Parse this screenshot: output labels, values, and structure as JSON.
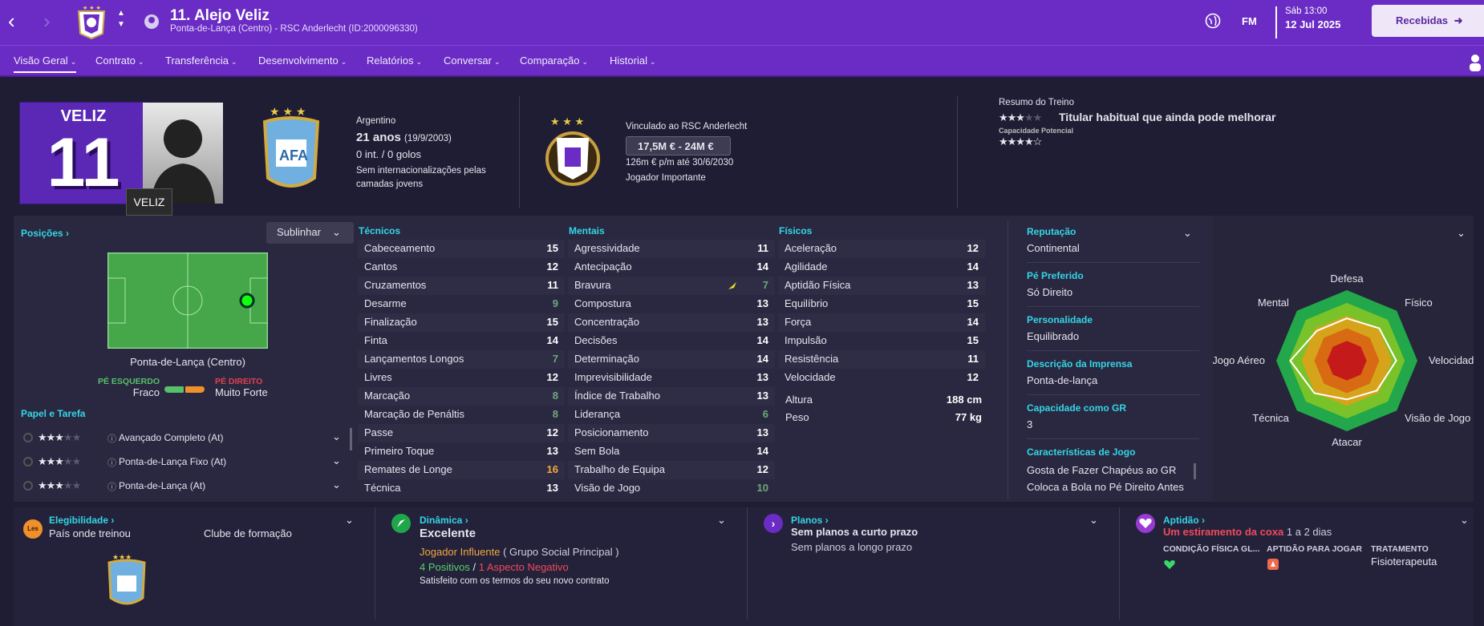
{
  "header": {
    "title": "11. Alejo Veliz",
    "subtitle": "Ponta-de-Lança (Centro) - RSC Anderlecht (ID:2000096330)",
    "fm": "FM",
    "time": "Sáb 13:00",
    "date": "12 Jul 2025",
    "inbox": "Recebidas"
  },
  "menu": [
    "Visão Geral",
    "Contrato",
    "Transferência",
    "Desenvolvimento",
    "Relatórios",
    "Conversar",
    "Comparação",
    "Historial"
  ],
  "profile": {
    "shirt_name": "VELIZ",
    "shirt_number": "11",
    "tooltip": "VELIZ",
    "nationality": "Argentino",
    "age": "21 anos",
    "dob": "(19/9/2003)",
    "caps": "0 int. / 0 golos",
    "youth": "Sem internacionalizações pelas camadas jovens",
    "contract_club": "Vinculado ao RSC Anderlecht",
    "value": "17,5M € - 24M €",
    "wage": "126m € p/m até 30/6/2030",
    "status": "Jogador Importante",
    "training_title": "Resumo do Treino",
    "training_text": "Titular habitual que ainda pode melhorar",
    "potential_label": "Capacidade Potencial",
    "current_stars": 3,
    "potential_stars": 4.5
  },
  "positions": {
    "label": "Posições",
    "highlight": "Sublinhar",
    "position": "Ponta-de-Lança (Centro)",
    "left_foot_label": "PÉ ESQUERDO",
    "left_foot": "Fraco",
    "right_foot_label": "PÉ DIREITO",
    "right_foot": "Muito Forte",
    "roles_label": "Papel e Tarefa",
    "roles": [
      "Avançado Completo (At)",
      "Ponta-de-Lança Fixo (At)",
      "Ponta-de-Lança (At)"
    ]
  },
  "technical": {
    "label": "Técnicos",
    "items": [
      {
        "n": "Cabeceamento",
        "v": "15"
      },
      {
        "n": "Cantos",
        "v": "12"
      },
      {
        "n": "Cruzamentos",
        "v": "11"
      },
      {
        "n": "Desarme",
        "v": "9"
      },
      {
        "n": "Finalização",
        "v": "15"
      },
      {
        "n": "Finta",
        "v": "14"
      },
      {
        "n": "Lançamentos Longos",
        "v": "7"
      },
      {
        "n": "Livres",
        "v": "12"
      },
      {
        "n": "Marcação",
        "v": "8"
      },
      {
        "n": "Marcação de Penáltis",
        "v": "8"
      },
      {
        "n": "Passe",
        "v": "12"
      },
      {
        "n": "Primeiro Toque",
        "v": "13"
      },
      {
        "n": "Remates de Longe",
        "v": "16"
      },
      {
        "n": "Técnica",
        "v": "13"
      }
    ]
  },
  "mental": {
    "label": "Mentais",
    "items": [
      {
        "n": "Agressividade",
        "v": "11"
      },
      {
        "n": "Antecipação",
        "v": "14"
      },
      {
        "n": "Bravura",
        "v": "7"
      },
      {
        "n": "Compostura",
        "v": "13"
      },
      {
        "n": "Concentração",
        "v": "13"
      },
      {
        "n": "Decisões",
        "v": "14"
      },
      {
        "n": "Determinação",
        "v": "14"
      },
      {
        "n": "Imprevisibilidade",
        "v": "13"
      },
      {
        "n": "Índice de Trabalho",
        "v": "13"
      },
      {
        "n": "Liderança",
        "v": "6"
      },
      {
        "n": "Posicionamento",
        "v": "13"
      },
      {
        "n": "Sem Bola",
        "v": "14"
      },
      {
        "n": "Trabalho de Equipa",
        "v": "12"
      },
      {
        "n": "Visão de Jogo",
        "v": "10"
      }
    ]
  },
  "physical": {
    "label": "Físicos",
    "items": [
      {
        "n": "Aceleração",
        "v": "12"
      },
      {
        "n": "Agilidade",
        "v": "14"
      },
      {
        "n": "Aptidão Física",
        "v": "13"
      },
      {
        "n": "Equilíbrio",
        "v": "15"
      },
      {
        "n": "Força",
        "v": "14"
      },
      {
        "n": "Impulsão",
        "v": "15"
      },
      {
        "n": "Resistência",
        "v": "11"
      },
      {
        "n": "Velocidade",
        "v": "12"
      }
    ],
    "height_label": "Altura",
    "height": "188 cm",
    "weight_label": "Peso",
    "weight": "77 kg"
  },
  "info": [
    {
      "k": "Reputação",
      "v": "Continental"
    },
    {
      "k": "Pé Preferido",
      "v": "Só Direito"
    },
    {
      "k": "Personalidade",
      "v": "Equilibrado"
    },
    {
      "k": "Descrição da Imprensa",
      "v": "Ponta-de-lança"
    },
    {
      "k": "Capacidade como GR",
      "v": "3"
    },
    {
      "k": "Características de Jogo",
      "v": "Gosta de Fazer Chapéus ao GR",
      "v2": "Coloca a Bola no Pé Direito Antes"
    }
  ],
  "radar": {
    "labels": [
      "Defesa",
      "Físico",
      "Velocidade",
      "Visão de Jogo",
      "Atacar",
      "Técnica",
      "Jogo Aéreo",
      "Mental"
    ],
    "values": [
      0.6,
      0.65,
      0.7,
      0.6,
      0.55,
      0.65,
      0.8,
      0.6
    ]
  },
  "bottom": {
    "eligibility_label": "Elegibilidade",
    "eligibility_badge": "Les",
    "trained_country": "País onde treinou",
    "trained_club": "Clube de formação",
    "dynamics_label": "Dinâmica",
    "dynamics_value": "Excelente",
    "influence": "Jogador Influente",
    "social_group": "( Grupo Social Principal )",
    "positives": "4 Positivos",
    "slash": "/",
    "negatives": "1 Aspecto Negativo",
    "satisfaction": "Satisfeito com os termos do seu novo contrato",
    "plans_label": "Planos",
    "plan_short": "Sem planos a curto prazo",
    "plan_long": "Sem planos a longo prazo",
    "fitness_label": "Aptidão",
    "injury": "Um estiramento da coxa",
    "injury_time": "1 a 2 dias",
    "col1": "CONDIÇÃO FÍSICA GL...",
    "col2": "APTIDÃO PARA JOGAR",
    "col3": "TRATAMENTO",
    "treatment": "Fisioterapeuta"
  },
  "colors": {
    "header": "#6a2cc4",
    "accent": "#33d6e6",
    "bg": "#1f1d33"
  }
}
